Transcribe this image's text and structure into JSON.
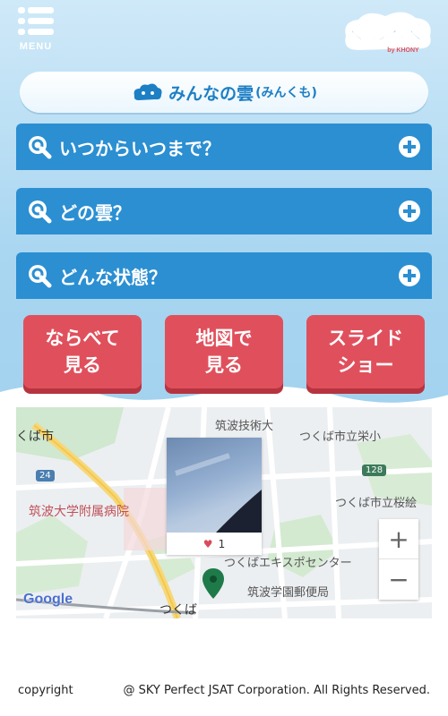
{
  "header": {
    "menu_label": "MENU",
    "logo_text": "くもろぐ",
    "logo_sub": "by KHONY",
    "icon_menu": "hamburger-icon"
  },
  "title": {
    "main": "みんなの雲",
    "sub": "(みんくも)",
    "icon": "cloud-mascot-icon"
  },
  "accordions": [
    {
      "label": "いつからいつまで？",
      "icon": "search-icon",
      "toggle_icon": "plus-icon"
    },
    {
      "label": "どの雲？",
      "icon": "search-icon",
      "toggle_icon": "plus-icon"
    },
    {
      "label": "どんな状態？",
      "icon": "search-icon",
      "toggle_icon": "plus-icon"
    }
  ],
  "buttons": [
    {
      "line1": "ならべて",
      "line2": "見る"
    },
    {
      "line1": "地図で",
      "line2": "見る"
    },
    {
      "line1": "スライド",
      "line2": "ショー"
    }
  ],
  "map": {
    "labels": {
      "tsukuba_city": "くば市",
      "univ_hospital": "筑波大学附属病院",
      "tech_univ": "筑波技術大",
      "sakae_school": "つくば市立栄小",
      "sakurai_school": "つくば市立桜絵",
      "expo_center": "つくばエキスポセンター",
      "post_office": "筑波学園郵便局",
      "station": "つくば",
      "route_128": "128",
      "route_24": "24"
    },
    "zoom_in": "+",
    "zoom_out": "−",
    "google": "Google",
    "popup_likes": "1",
    "marker_icon": "map-pin-icon"
  },
  "footer": {
    "left": "copyright",
    "right": "@ SKY Perfect JSAT Corporation. All Rights Reserved."
  },
  "colors": {
    "accent_blue": "#2b8fd2",
    "button_red": "#e0505c",
    "title_blue": "#1d7fc4"
  }
}
